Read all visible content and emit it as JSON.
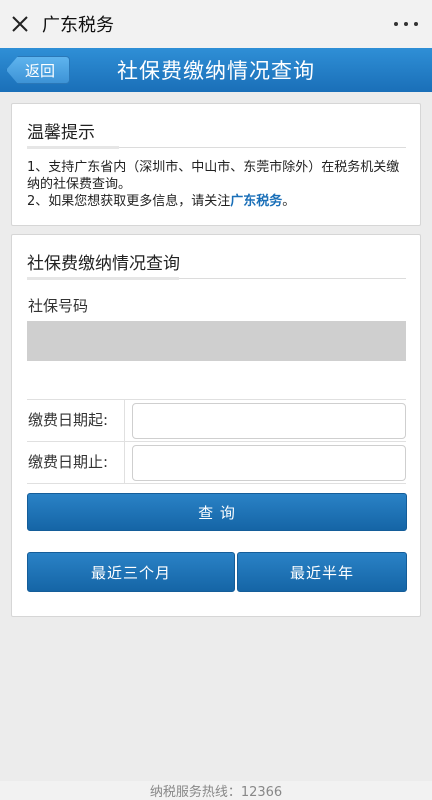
{
  "topbar": {
    "close_icon": "close-icon",
    "title": "广东税务",
    "more_icon": "more-dots-icon"
  },
  "header": {
    "back_label": "返回",
    "title": "社保费缴纳情况查询"
  },
  "tips": {
    "title": "温馨提示",
    "line1": "1、支持广东省内（深圳市、中山市、东莞市除外）在税务机关缴纳的社保费查询。",
    "line2_prefix": "2、如果您想获取更多信息，请关注",
    "line2_link": "广东税务",
    "line2_suffix": "。"
  },
  "query": {
    "title": "社保费缴纳情况查询",
    "ss_number_label": "社保号码",
    "ss_number_value": "",
    "date_start_label": "缴费日期起:",
    "date_start_value": "",
    "date_end_label": "缴费日期止:",
    "date_end_value": "",
    "search_label": "查 询",
    "recent_3m_label": "最近三个月",
    "recent_6m_label": "最近半年"
  },
  "footer": {
    "hotline": "纳税服务热线：12366"
  }
}
